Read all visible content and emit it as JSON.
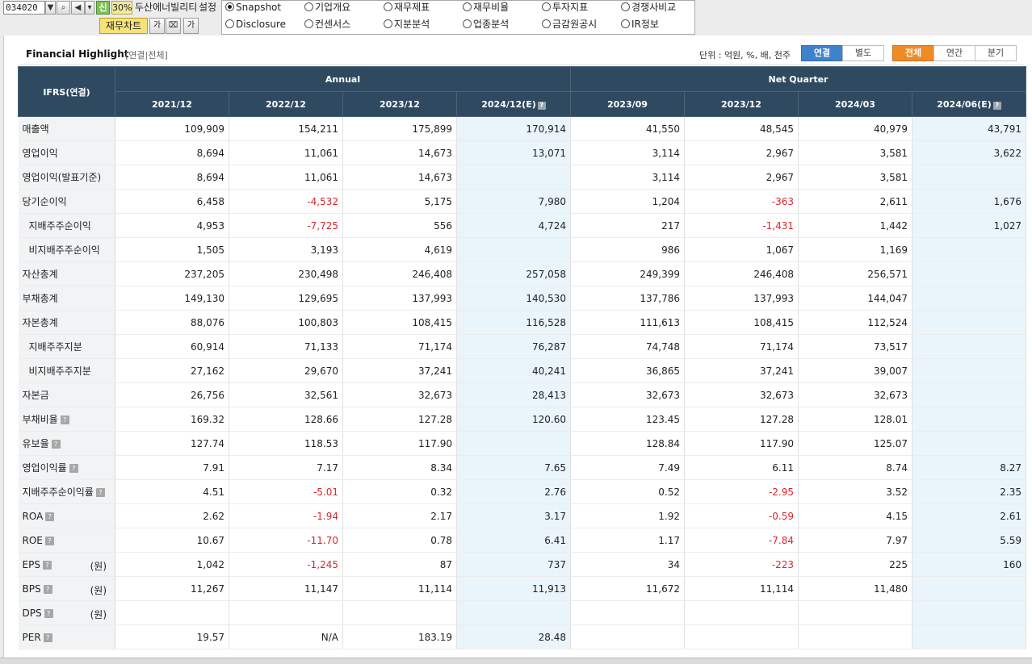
{
  "toolbar": {
    "code": "034020",
    "new_label": "신",
    "zoom": "30%",
    "company": "두산에너빌리티",
    "setting": "설정",
    "chart_button": "재무차트",
    "icon_a": "가",
    "icon_b": "가"
  },
  "tabs": [
    {
      "label": "Snapshot",
      "selected": true
    },
    {
      "label": "기업개요",
      "selected": false
    },
    {
      "label": "재무제표",
      "selected": false
    },
    {
      "label": "재무비율",
      "selected": false
    },
    {
      "label": "투자지표",
      "selected": false
    },
    {
      "label": "경쟁사비교",
      "selected": false
    },
    {
      "label": "Disclosure",
      "selected": false
    },
    {
      "label": "컨센서스",
      "selected": false
    },
    {
      "label": "지분분석",
      "selected": false
    },
    {
      "label": "업종분석",
      "selected": false
    },
    {
      "label": "금감원공시",
      "selected": false
    },
    {
      "label": "IR정보",
      "selected": false
    }
  ],
  "panel": {
    "title": "Financial Highlight",
    "subtitle": "[연결|전체]",
    "unit": "단위 : 억원, %, 배, 천주",
    "toggle_consolidated": "연결",
    "toggle_separate": "별도",
    "toggle_all": "전체",
    "toggle_annual": "연간",
    "toggle_quarter": "분기"
  },
  "table": {
    "corner": "IFRS(연결)",
    "group_annual": "Annual",
    "group_quarter": "Net Quarter",
    "columns": [
      "2021/12",
      "2022/12",
      "2023/12",
      "2024/12(E)",
      "2023/09",
      "2023/12",
      "2024/03",
      "2024/06(E)"
    ],
    "rows": [
      {
        "label": "매출액",
        "sub": false,
        "help": false,
        "unit": "",
        "values": [
          "109,909",
          "154,211",
          "175,899",
          "170,914",
          "41,550",
          "48,545",
          "40,979",
          "43,791"
        ]
      },
      {
        "label": "영업이익",
        "sub": false,
        "help": false,
        "unit": "",
        "values": [
          "8,694",
          "11,061",
          "14,673",
          "13,071",
          "3,114",
          "2,967",
          "3,581",
          "3,622"
        ]
      },
      {
        "label": "영업이익(발표기준)",
        "sub": false,
        "help": false,
        "unit": "",
        "values": [
          "8,694",
          "11,061",
          "14,673",
          "",
          "3,114",
          "2,967",
          "3,581",
          ""
        ]
      },
      {
        "label": "당기순이익",
        "sub": false,
        "help": false,
        "unit": "",
        "values": [
          "6,458",
          "-4,532",
          "5,175",
          "7,980",
          "1,204",
          "-363",
          "2,611",
          "1,676"
        ]
      },
      {
        "label": "지배주주순이익",
        "sub": true,
        "help": false,
        "unit": "",
        "values": [
          "4,953",
          "-7,725",
          "556",
          "4,724",
          "217",
          "-1,431",
          "1,442",
          "1,027"
        ]
      },
      {
        "label": "비지배주주순이익",
        "sub": true,
        "help": false,
        "unit": "",
        "values": [
          "1,505",
          "3,193",
          "4,619",
          "",
          "986",
          "1,067",
          "1,169",
          ""
        ]
      },
      {
        "label": "자산총계",
        "sub": false,
        "help": false,
        "unit": "",
        "values": [
          "237,205",
          "230,498",
          "246,408",
          "257,058",
          "249,399",
          "246,408",
          "256,571",
          ""
        ]
      },
      {
        "label": "부채총계",
        "sub": false,
        "help": false,
        "unit": "",
        "values": [
          "149,130",
          "129,695",
          "137,993",
          "140,530",
          "137,786",
          "137,993",
          "144,047",
          ""
        ]
      },
      {
        "label": "자본총계",
        "sub": false,
        "help": false,
        "unit": "",
        "values": [
          "88,076",
          "100,803",
          "108,415",
          "116,528",
          "111,613",
          "108,415",
          "112,524",
          ""
        ]
      },
      {
        "label": "지배주주지분",
        "sub": true,
        "help": false,
        "unit": "",
        "values": [
          "60,914",
          "71,133",
          "71,174",
          "76,287",
          "74,748",
          "71,174",
          "73,517",
          ""
        ]
      },
      {
        "label": "비지배주주지분",
        "sub": true,
        "help": false,
        "unit": "",
        "values": [
          "27,162",
          "29,670",
          "37,241",
          "40,241",
          "36,865",
          "37,241",
          "39,007",
          ""
        ]
      },
      {
        "label": "자본금",
        "sub": false,
        "help": false,
        "unit": "",
        "values": [
          "26,756",
          "32,561",
          "32,673",
          "28,413",
          "32,673",
          "32,673",
          "32,673",
          ""
        ]
      },
      {
        "label": "부채비율",
        "sub": false,
        "help": true,
        "unit": "",
        "values": [
          "169.32",
          "128.66",
          "127.28",
          "120.60",
          "123.45",
          "127.28",
          "128.01",
          ""
        ]
      },
      {
        "label": "유보율",
        "sub": false,
        "help": true,
        "unit": "",
        "values": [
          "127.74",
          "118.53",
          "117.90",
          "",
          "128.84",
          "117.90",
          "125.07",
          ""
        ]
      },
      {
        "label": "영업이익률",
        "sub": false,
        "help": true,
        "unit": "",
        "values": [
          "7.91",
          "7.17",
          "8.34",
          "7.65",
          "7.49",
          "6.11",
          "8.74",
          "8.27"
        ]
      },
      {
        "label": "지배주주순이익률",
        "sub": false,
        "help": true,
        "unit": "",
        "values": [
          "4.51",
          "-5.01",
          "0.32",
          "2.76",
          "0.52",
          "-2.95",
          "3.52",
          "2.35"
        ]
      },
      {
        "label": "ROA",
        "sub": false,
        "help": true,
        "unit": "",
        "values": [
          "2.62",
          "-1.94",
          "2.17",
          "3.17",
          "1.92",
          "-0.59",
          "4.15",
          "2.61"
        ]
      },
      {
        "label": "ROE",
        "sub": false,
        "help": true,
        "unit": "",
        "values": [
          "10.67",
          "-11.70",
          "0.78",
          "6.41",
          "1.17",
          "-7.84",
          "7.97",
          "5.59"
        ]
      },
      {
        "label": "EPS",
        "sub": false,
        "help": true,
        "unit": "(원)",
        "values": [
          "1,042",
          "-1,245",
          "87",
          "737",
          "34",
          "-223",
          "225",
          "160"
        ]
      },
      {
        "label": "BPS",
        "sub": false,
        "help": true,
        "unit": "(원)",
        "values": [
          "11,267",
          "11,147",
          "11,114",
          "11,913",
          "11,672",
          "11,114",
          "11,480",
          ""
        ]
      },
      {
        "label": "DPS",
        "sub": false,
        "help": true,
        "unit": "(원)",
        "values": [
          "",
          "",
          "",
          "",
          "",
          "",
          "",
          ""
        ]
      },
      {
        "label": "PER",
        "sub": false,
        "help": true,
        "unit": "",
        "values": [
          "19.57",
          "N/A",
          "183.19",
          "28.48",
          "",
          "",
          "",
          ""
        ]
      }
    ]
  }
}
